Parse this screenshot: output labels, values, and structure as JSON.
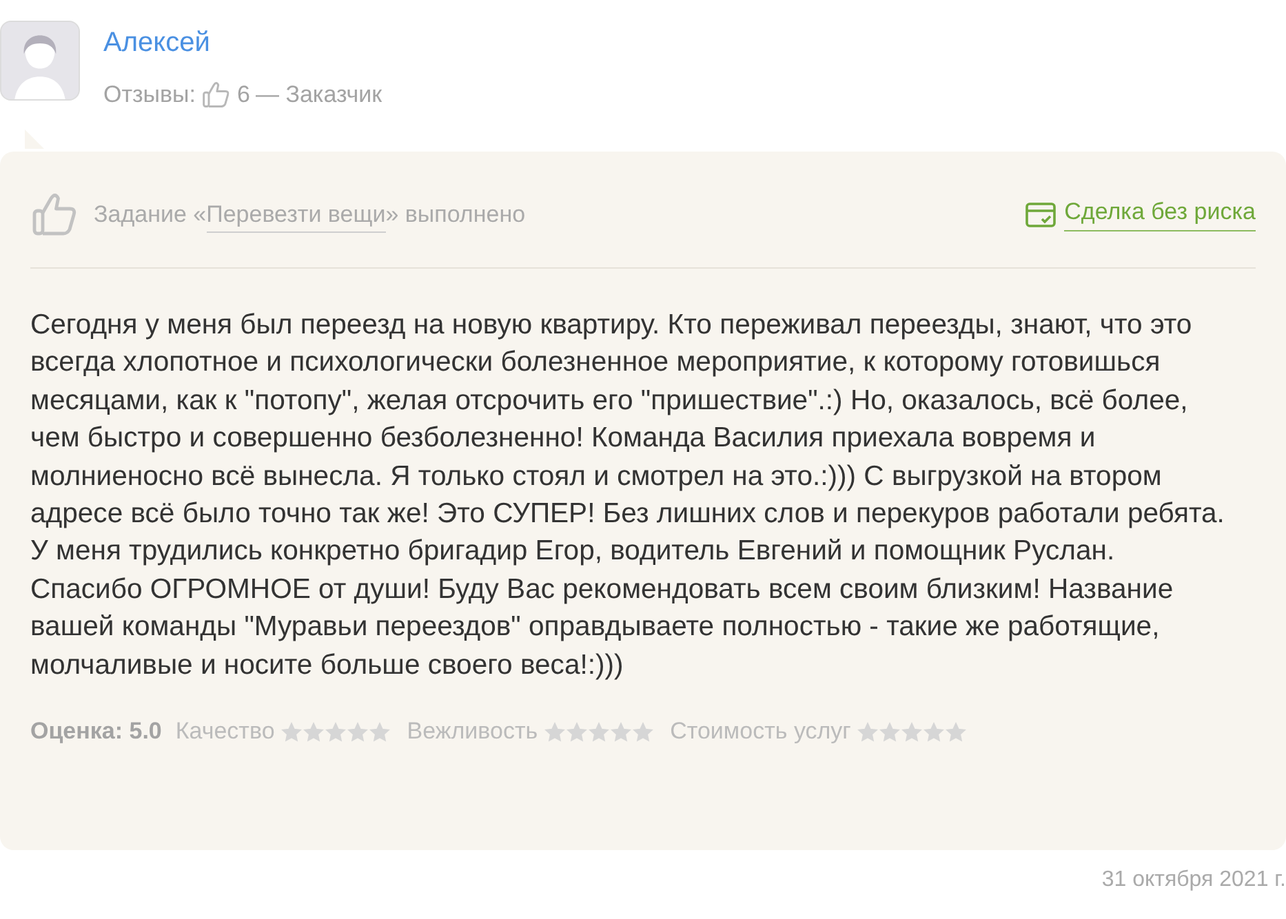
{
  "author": {
    "name": "Алексей",
    "reviews_label": "Отзывы:",
    "reviews_count": "6",
    "role": "— Заказчик"
  },
  "review": {
    "task_prefix": "Задание «",
    "task_link": "Перевезти вещи",
    "task_suffix": "» выполнено",
    "safe_deal": "Сделка без риска",
    "text": "Сегодня у меня был переезд на новую квартиру. Кто переживал переезды, знают, что это всегда хлопотное и психологически болезненное мероприятие, к которому готовишься месяцами, как к \"потопу\", желая отсрочить его \"пришествие\".:) Но, оказалось, всё более, чем быстро и совершенно безболезненно! Команда Василия приехала вовремя и молниеносно всё вынесла. Я только стоял и смотрел на это.:))) С выгрузкой на втором адресе всё было точно так же! Это СУПЕР! Без лишних слов и перекуров работали ребята. У меня трудились конкретно бригадир Егор, водитель Евгений и помощник Руслан. Спасибо ОГРОМНОЕ от души! Буду Вас рекомендовать всем своим близким! Название вашей команды \"Муравьи переездов\" оправдываете полностью - такие же работящие, молчаливые и носите больше своего веса!:)))",
    "score": "Оценка: 5.0",
    "ratings": [
      {
        "label": "Качество"
      },
      {
        "label": "Вежливость"
      },
      {
        "label": "Стоимость услуг"
      }
    ]
  },
  "date": "31 октября 2021 г."
}
